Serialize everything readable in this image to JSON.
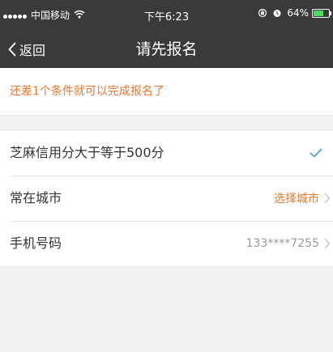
{
  "status_bar": {
    "carrier": "中国移动",
    "time": "下午6:23",
    "battery_percent": "64%",
    "battery_level": 0.64,
    "icons": [
      "signal-dots-icon",
      "wifi-icon",
      "orientation-lock-icon",
      "alarm-icon",
      "battery-icon"
    ]
  },
  "nav": {
    "back_label": "返回",
    "title": "请先报名"
  },
  "notice": {
    "text": "还差1个条件就可以完成报名了"
  },
  "conditions": [
    {
      "label": "芝麻信用分大于等于500分",
      "status": "check-icon"
    },
    {
      "label": "常在城市",
      "value": "选择城市"
    },
    {
      "label": "手机号码",
      "value": "133****7255"
    }
  ],
  "colors": {
    "header_bg": "#3a3a3a",
    "accent_orange": "#e8772e",
    "check_blue": "#4aa3df",
    "page_bg": "#f2f2f2",
    "battery_green": "#4cd964"
  }
}
